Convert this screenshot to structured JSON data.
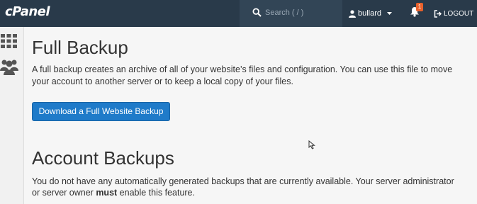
{
  "header": {
    "logo": "cPanel",
    "search_placeholder": "Search ( / )",
    "username": "bullard",
    "notification_count": "1",
    "logout_label": "LOGOUT"
  },
  "sidebar": {
    "items": [
      {
        "icon": "grid-icon"
      },
      {
        "icon": "users-icon"
      }
    ]
  },
  "main": {
    "full_backup": {
      "title": "Full Backup",
      "description": "A full backup creates an archive of all of your website’s files and configuration. You can use this file to move your account to another server or to keep a local copy of your files.",
      "button_label": "Download a Full Website Backup"
    },
    "account_backups": {
      "title": "Account Backups",
      "description_before": "You do not have any automatically generated backups that are currently available. Your server administrator or server owner ",
      "description_bold": "must",
      "description_after": " enable this feature."
    }
  },
  "colors": {
    "topbar": "#293a4a",
    "accent": "#1f7bc9",
    "badge": "#e8612c"
  }
}
